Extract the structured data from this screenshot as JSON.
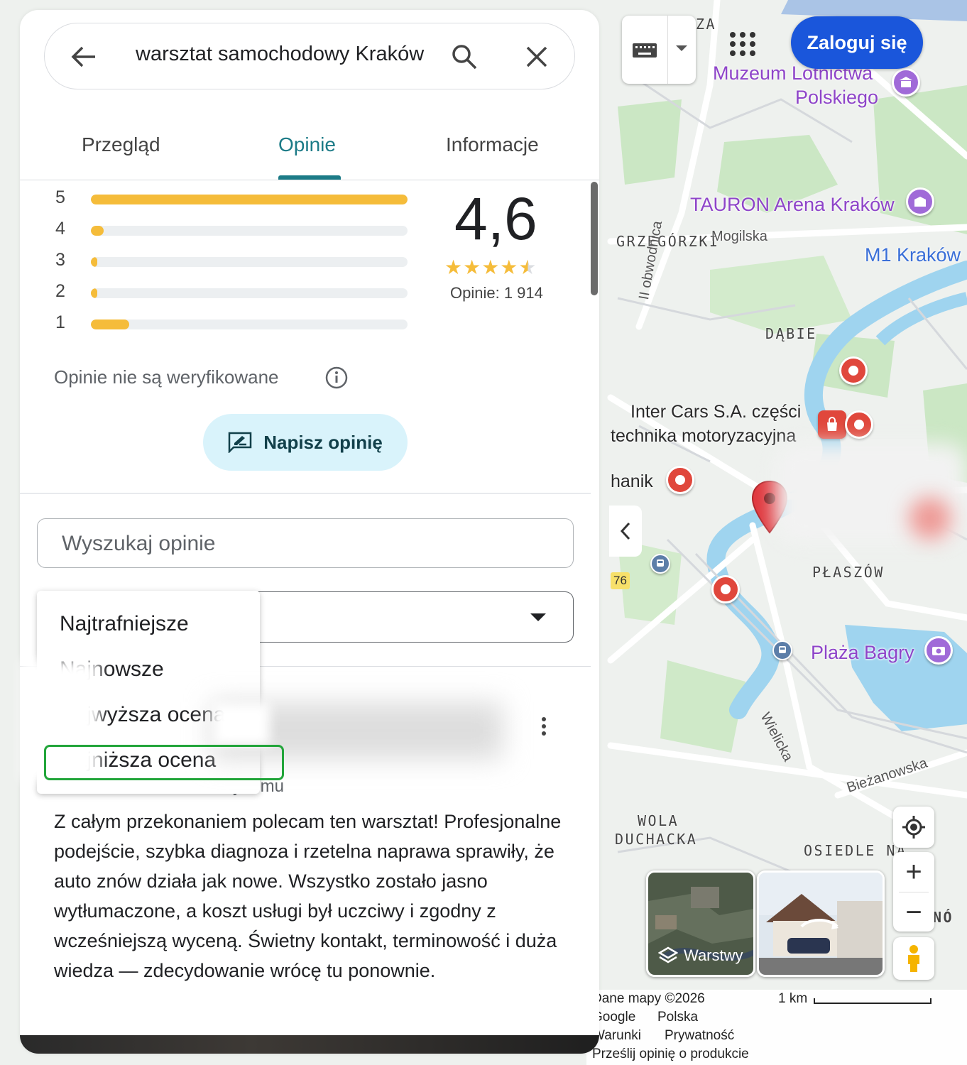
{
  "panel": {
    "search": {
      "value": "warsztat samochodowy Kraków"
    },
    "tabs": [
      {
        "label": "Przegląd"
      },
      {
        "label": "Opinie"
      },
      {
        "label": "Informacje"
      }
    ],
    "ratings": {
      "distribution": [
        {
          "stars": "5",
          "fraction": 1.0
        },
        {
          "stars": "4",
          "fraction": 0.04
        },
        {
          "stars": "3",
          "fraction": 0.02
        },
        {
          "stars": "2",
          "fraction": 0.02
        },
        {
          "stars": "1",
          "fraction": 0.12
        }
      ],
      "average": "4,6",
      "stars": "★★★★",
      "half_star": "★",
      "count": "Opinie: 1 914"
    },
    "unverified_note": "Opinie nie są weryfikowane",
    "write_review_label": "Napisz opinię",
    "review_search": {
      "placeholder": "Wyszukaj opinie"
    },
    "sort_menu": [
      {
        "label": "Najtrafniejsze"
      },
      {
        "label": "Najnowsze"
      },
      {
        "label": "Najwyższa ocena"
      },
      {
        "label": "Najniższa ocena"
      }
    ],
    "review": {
      "subline": "y temu",
      "text": "Z całym przekonaniem polecam ten warsztat! Profesjonalne podejście, szybka diagnoza i rzetelna naprawa sprawiły, że auto znów działa jak nowe. Wszystko zostało jasno wytłumaczone, a koszt usługi był uczciwy i zgodny z wcześniejszą wyceną. Świetny kontakt, terminowość i duża wiedza — zdecydowanie wrócę tu ponownie."
    }
  },
  "map": {
    "login_label": "Zaloguj się",
    "labels": {
      "top_partial": "ZA",
      "muzeum": "Muzeum Lotnictwa",
      "muzeum2": "Polskiego",
      "tauron": "TAURON Arena Kraków",
      "m1": "M1 Kraków",
      "grzegorzki": "GRZEGÓRZKI",
      "mogilska": "Mogilska",
      "obwodnica": "II obwodnica",
      "dabie": "DĄBIE",
      "intercars1": "Inter Cars S.A. części",
      "intercars2": "technika motoryzacyjna",
      "hanik": "hanik",
      "plaszow": "PŁASZÓW",
      "road76": "76",
      "plaza": "Plaża Bagry",
      "wielicka": "Wielicka",
      "biezanowska": "Bieżanowska",
      "wola1": "WOLA",
      "wola2": "DUCHACKA",
      "osiedle": "OSIEDLE NA",
      "no": "NÓ"
    },
    "layers_label": "Warstwy",
    "attribution": {
      "data": "Dane mapy ©2026",
      "scale": "1 km",
      "google": "Google",
      "polska": "Polska",
      "terms": "Warunki",
      "privacy": "Prywatność",
      "feedback": "Prześlij opinię o produkcie"
    },
    "colors": {
      "accent": "#1c7b87",
      "login": "#1a56db",
      "river": "#8fd0f0",
      "park": "#c6e8c2"
    }
  }
}
